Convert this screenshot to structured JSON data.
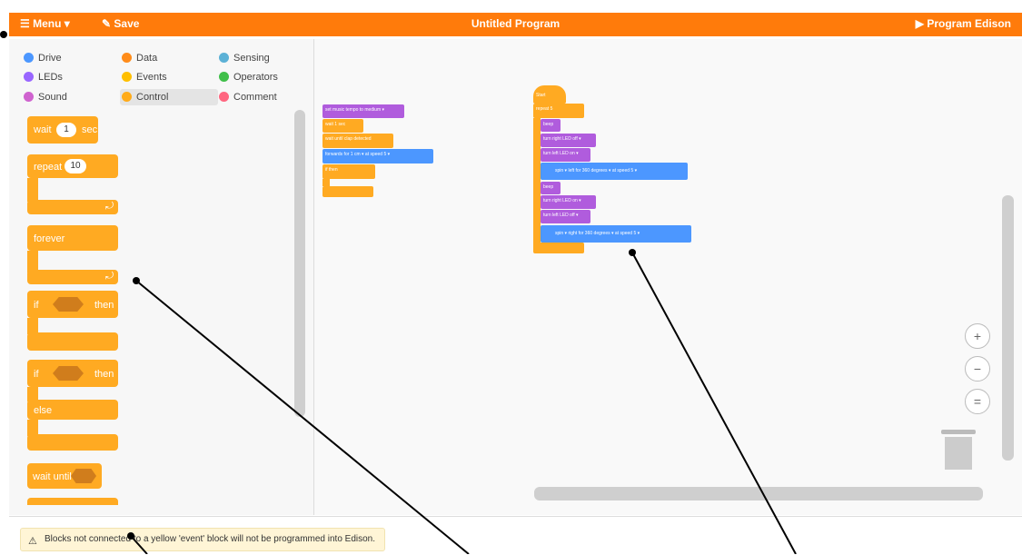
{
  "header": {
    "menu_label": "☰ Menu ▾",
    "save_label": "✎ Save",
    "title": "Untitled Program",
    "program_label": "▶ Program Edison"
  },
  "categories": [
    {
      "label": "Drive",
      "color": "#4c97ff"
    },
    {
      "label": "Data",
      "color": "#ff8c1a"
    },
    {
      "label": "Sensing",
      "color": "#5cb1d6"
    },
    {
      "label": "LEDs",
      "color": "#9966ff"
    },
    {
      "label": "Events",
      "color": "#ffbf00"
    },
    {
      "label": "Operators",
      "color": "#40bf4a"
    },
    {
      "label": "Sound",
      "color": "#cf63cf"
    },
    {
      "label": "Control",
      "color": "#ffab19",
      "selected": true
    },
    {
      "label": "Comment",
      "color": "#ff6680"
    }
  ],
  "palette_blocks": {
    "wait": "wait",
    "wait_value": "1",
    "wait_unit": "sec",
    "repeat": "repeat",
    "repeat_value": "10",
    "forever": "forever",
    "if": "if",
    "then": "then",
    "if2": "if",
    "then2": "then",
    "else": "else",
    "wait_until": "wait until"
  },
  "workspace": {
    "stack1": {
      "tempo": "set music tempo to   medium ▾",
      "wait": "wait  1  sec",
      "wait_until": "wait until   clap detected",
      "forwards": "forwards for  1  cm ▾   at speed  5 ▾",
      "if": "if          then"
    },
    "stack2": {
      "start": "Start",
      "repeat": "repeat  5",
      "beep1": "beep",
      "right_led_off": "turn right LED  off ▾",
      "left_led_on": "turn left LED  on ▾",
      "spin_left": "spin ▾  left for  360  degrees ▾  at speed  5 ▾",
      "beep2": "beep",
      "right_led_on": "turn right LED  on ▾",
      "left_led_off": "turn left LED  off ▾",
      "spin_right": "spin ▾  right for  360  degrees ▾  at speed  5 ▾"
    }
  },
  "zoom": {
    "in": "+",
    "out": "−",
    "reset": "="
  },
  "footer": {
    "warning_icon": "⚠",
    "warning": "Blocks not connected to a yellow 'event' block will not be programmed into Edison."
  },
  "colors": {
    "accent": "#ff7b0b",
    "control": "#ffaa22",
    "drive": "#4c97ff",
    "leds": "#b05cdd"
  }
}
